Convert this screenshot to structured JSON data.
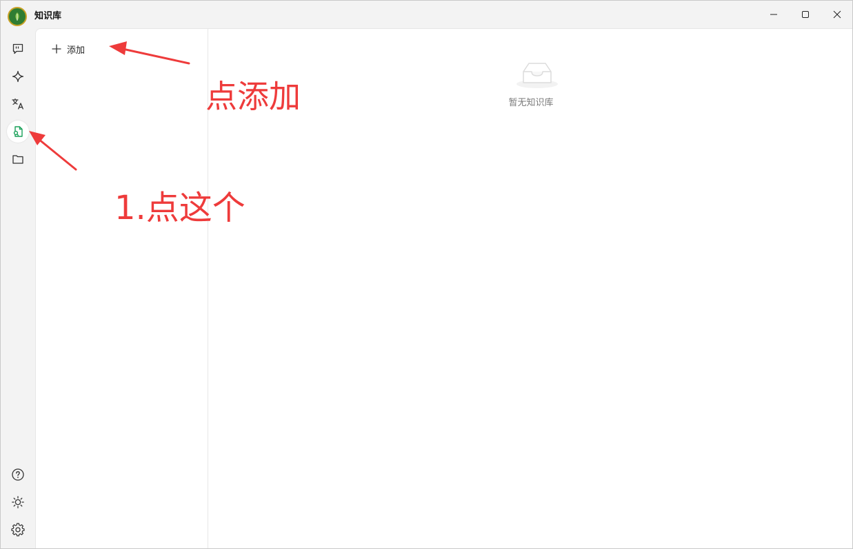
{
  "app": {
    "title": "知识库"
  },
  "window_controls": {
    "minimize": "minimize-icon",
    "maximize": "maximize-icon",
    "close": "close-icon"
  },
  "sidebar": {
    "top_items": [
      {
        "icon": "chat-icon"
      },
      {
        "icon": "sparkle-icon"
      },
      {
        "icon": "translate-icon"
      },
      {
        "icon": "knowledge-base-icon",
        "active": true
      },
      {
        "icon": "folder-icon"
      }
    ],
    "bottom_items": [
      {
        "icon": "help-icon"
      },
      {
        "icon": "theme-icon"
      },
      {
        "icon": "settings-icon"
      }
    ]
  },
  "list_panel": {
    "add_label": "添加"
  },
  "main": {
    "empty_text": "暂无知识库"
  },
  "annotations": {
    "click_add": "点添加",
    "click_this": "1.点这个"
  },
  "colors": {
    "accent": "#18a058",
    "annotation": "#ee3b3b"
  }
}
